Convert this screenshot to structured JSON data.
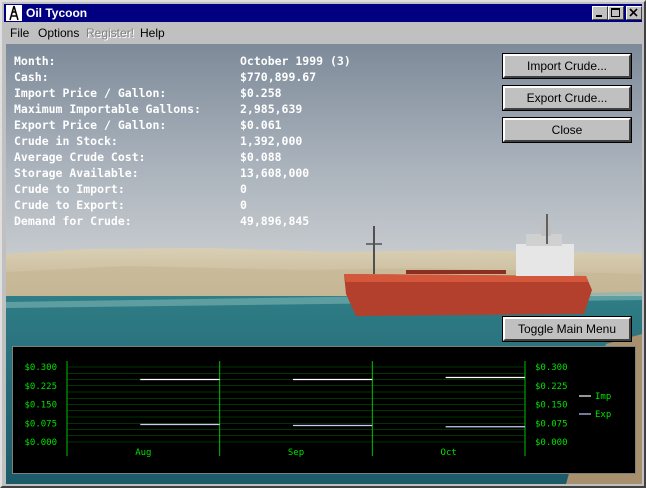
{
  "window": {
    "title": "Oil Tycoon"
  },
  "menu": [
    {
      "label": "File",
      "enabled": true
    },
    {
      "label": "Options",
      "enabled": true
    },
    {
      "label": "Register!",
      "enabled": false
    },
    {
      "label": "Help",
      "enabled": true
    }
  ],
  "info": [
    {
      "label": "Month:",
      "value": "October 1999 (3)"
    },
    {
      "label": "Cash:",
      "value": "$770,899.67"
    },
    {
      "label": "Import Price / Gallon:",
      "value": "$0.258"
    },
    {
      "label": "Maximum Importable Gallons:",
      "value": "2,985,639"
    },
    {
      "label": "Export Price / Gallon:",
      "value": "$0.061"
    },
    {
      "label": "Crude in Stock:",
      "value": "1,392,000"
    },
    {
      "label": "Average Crude Cost:",
      "value": "$0.088"
    },
    {
      "label": "Storage Available:",
      "value": "13,608,000"
    },
    {
      "label": "Crude to Import:",
      "value": "0"
    },
    {
      "label": "Crude to Export:",
      "value": "0"
    },
    {
      "label": "Demand for Crude:",
      "value": "49,896,845"
    }
  ],
  "buttons": {
    "import": "Import Crude...",
    "export": "Export Crude...",
    "close": "Close",
    "toggle": "Toggle Main Menu"
  },
  "colors": {
    "title_bar": "#000080",
    "grid": "#00c000",
    "axis_text": "#00e000",
    "imp_line": "#ffffff",
    "exp_line": "#c8c8ff"
  },
  "chart_data": {
    "type": "line",
    "categories": [
      "Aug",
      "Sep",
      "Oct"
    ],
    "y_tick_labels": [
      "$0.300",
      "$0.225",
      "$0.150",
      "$0.075",
      "$0.000"
    ],
    "ylim": [
      0,
      0.3
    ],
    "series": [
      {
        "name": "Imp",
        "values": [
          0.25,
          0.25,
          0.258
        ]
      },
      {
        "name": "Exp",
        "values": [
          0.07,
          0.066,
          0.061
        ]
      }
    ],
    "grid": true,
    "legend": "right"
  }
}
